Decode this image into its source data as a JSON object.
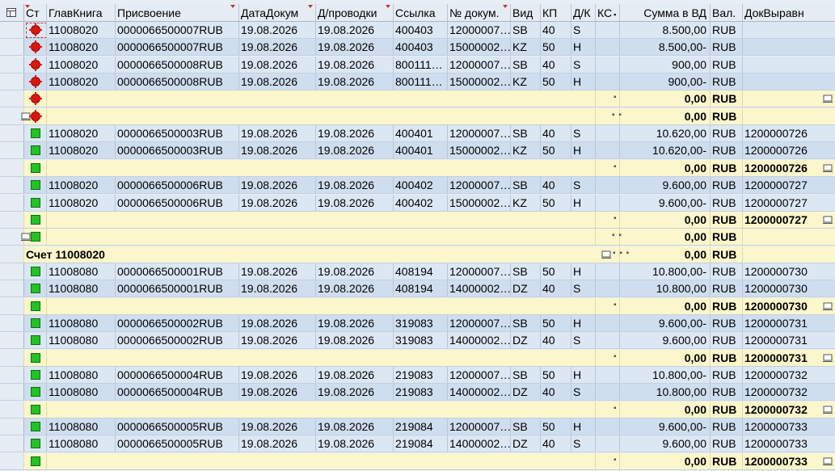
{
  "columns": {
    "status": "Ст",
    "gl": "ГлавКнига",
    "assign": "Присвоение",
    "docdate": "ДатаДокум",
    "postdate": "Д/проводки",
    "ref": "Ссылка",
    "docno": "№ докум.",
    "type": "Вид",
    "pk": "КП",
    "dc": "Д/К",
    "cs": "КС",
    "amount": "Сумма в ВД",
    "cur": "Вал.",
    "clr": "ДокВыравн"
  },
  "rows": [
    {
      "kind": "data",
      "status": "red",
      "gl": "11008020",
      "assign": "0000066500007RUB",
      "docdate": "19.08.2026",
      "postdate": "19.08.2026",
      "ref": "400403",
      "docno": "12000007…",
      "type": "SB",
      "pk": "40",
      "dc": "S",
      "amount": "8.500,00",
      "cur": "RUB",
      "clr": ""
    },
    {
      "kind": "data",
      "status": "red",
      "gl": "11008020",
      "assign": "0000066500007RUB",
      "docdate": "19.08.2026",
      "postdate": "19.08.2026",
      "ref": "400403",
      "docno": "15000002…",
      "type": "KZ",
      "pk": "50",
      "dc": "H",
      "amount": "8.500,00-",
      "cur": "RUB",
      "clr": ""
    },
    {
      "kind": "data",
      "status": "red",
      "gl": "11008020",
      "assign": "0000066500008RUB",
      "docdate": "19.08.2026",
      "postdate": "19.08.2026",
      "ref": "800111…",
      "docno": "12000007…",
      "type": "SB",
      "pk": "40",
      "dc": "S",
      "amount": "900,00",
      "cur": "RUB",
      "clr": ""
    },
    {
      "kind": "data",
      "status": "red",
      "gl": "11008020",
      "assign": "0000066500008RUB",
      "docdate": "19.08.2026",
      "postdate": "19.08.2026",
      "ref": "800111…",
      "docno": "15000002…",
      "type": "KZ",
      "pk": "50",
      "dc": "H",
      "amount": "900,00-",
      "cur": "RUB",
      "clr": ""
    },
    {
      "kind": "sub",
      "status": "red",
      "dots": "▪",
      "amount": "0,00",
      "cur": "RUB",
      "clr": "",
      "sumicon": true
    },
    {
      "kind": "sub",
      "status": "red",
      "lvl2": true,
      "dots": "▪ ▪",
      "amount": "0,00",
      "cur": "RUB",
      "clr": ""
    },
    {
      "kind": "data",
      "status": "green",
      "gl": "11008020",
      "assign": "0000066500003RUB",
      "docdate": "19.08.2026",
      "postdate": "19.08.2026",
      "ref": "400401",
      "docno": "12000007…",
      "type": "SB",
      "pk": "40",
      "dc": "S",
      "amount": "10.620,00",
      "cur": "RUB",
      "clr": "1200000726"
    },
    {
      "kind": "data",
      "status": "green",
      "gl": "11008020",
      "assign": "0000066500003RUB",
      "docdate": "19.08.2026",
      "postdate": "19.08.2026",
      "ref": "400401",
      "docno": "15000002…",
      "type": "KZ",
      "pk": "50",
      "dc": "H",
      "amount": "10.620,00-",
      "cur": "RUB",
      "clr": "1200000726"
    },
    {
      "kind": "sub",
      "status": "green",
      "dots": "▪",
      "amount": "0,00",
      "cur": "RUB",
      "clr": "1200000726",
      "sumicon": true
    },
    {
      "kind": "data",
      "status": "green",
      "gl": "11008020",
      "assign": "0000066500006RUB",
      "docdate": "19.08.2026",
      "postdate": "19.08.2026",
      "ref": "400402",
      "docno": "12000007…",
      "type": "SB",
      "pk": "40",
      "dc": "S",
      "amount": "9.600,00",
      "cur": "RUB",
      "clr": "1200000727"
    },
    {
      "kind": "data",
      "status": "green",
      "gl": "11008020",
      "assign": "0000066500006RUB",
      "docdate": "19.08.2026",
      "postdate": "19.08.2026",
      "ref": "400402",
      "docno": "15000002…",
      "type": "KZ",
      "pk": "50",
      "dc": "H",
      "amount": "9.600,00-",
      "cur": "RUB",
      "clr": "1200000727"
    },
    {
      "kind": "sub",
      "status": "green",
      "dots": "▪",
      "amount": "0,00",
      "cur": "RUB",
      "clr": "1200000727",
      "sumicon": true
    },
    {
      "kind": "sub",
      "status": "green",
      "lvl2": true,
      "dots": "▪ ▪",
      "amount": "0,00",
      "cur": "RUB",
      "clr": ""
    },
    {
      "kind": "total",
      "label": "Счет 11008020",
      "dots": "▪ ▪ ▪",
      "amount": "0,00",
      "cur": "RUB",
      "clr": ""
    },
    {
      "kind": "data",
      "status": "green",
      "gl": "11008080",
      "assign": "0000066500001RUB",
      "docdate": "19.08.2026",
      "postdate": "19.08.2026",
      "ref": "408194",
      "docno": "12000007…",
      "type": "SB",
      "pk": "50",
      "dc": "H",
      "amount": "10.800,00-",
      "cur": "RUB",
      "clr": "1200000730"
    },
    {
      "kind": "data",
      "status": "green",
      "gl": "11008080",
      "assign": "0000066500001RUB",
      "docdate": "19.08.2026",
      "postdate": "19.08.2026",
      "ref": "408194",
      "docno": "14000002…",
      "type": "DZ",
      "pk": "40",
      "dc": "S",
      "amount": "10.800,00",
      "cur": "RUB",
      "clr": "1200000730"
    },
    {
      "kind": "sub",
      "status": "green",
      "dots": "▪",
      "amount": "0,00",
      "cur": "RUB",
      "clr": "1200000730",
      "sumicon": true
    },
    {
      "kind": "data",
      "status": "green",
      "gl": "11008080",
      "assign": "0000066500002RUB",
      "docdate": "19.08.2026",
      "postdate": "19.08.2026",
      "ref": "319083",
      "docno": "12000007…",
      "type": "SB",
      "pk": "50",
      "dc": "H",
      "amount": "9.600,00-",
      "cur": "RUB",
      "clr": "1200000731"
    },
    {
      "kind": "data",
      "status": "green",
      "gl": "11008080",
      "assign": "0000066500002RUB",
      "docdate": "19.08.2026",
      "postdate": "19.08.2026",
      "ref": "319083",
      "docno": "14000002…",
      "type": "DZ",
      "pk": "40",
      "dc": "S",
      "amount": "9.600,00",
      "cur": "RUB",
      "clr": "1200000731"
    },
    {
      "kind": "sub",
      "status": "green",
      "dots": "▪",
      "amount": "0,00",
      "cur": "RUB",
      "clr": "1200000731",
      "sumicon": true
    },
    {
      "kind": "data",
      "status": "green",
      "gl": "11008080",
      "assign": "0000066500004RUB",
      "docdate": "19.08.2026",
      "postdate": "19.08.2026",
      "ref": "219083",
      "docno": "12000007…",
      "type": "SB",
      "pk": "50",
      "dc": "H",
      "amount": "10.800,00-",
      "cur": "RUB",
      "clr": "1200000732"
    },
    {
      "kind": "data",
      "status": "green",
      "gl": "11008080",
      "assign": "0000066500004RUB",
      "docdate": "19.08.2026",
      "postdate": "19.08.2026",
      "ref": "219083",
      "docno": "14000002…",
      "type": "DZ",
      "pk": "40",
      "dc": "S",
      "amount": "10.800,00",
      "cur": "RUB",
      "clr": "1200000732"
    },
    {
      "kind": "sub",
      "status": "green",
      "dots": "▪",
      "amount": "0,00",
      "cur": "RUB",
      "clr": "1200000732",
      "sumicon": true
    },
    {
      "kind": "data",
      "status": "green",
      "gl": "11008080",
      "assign": "0000066500005RUB",
      "docdate": "19.08.2026",
      "postdate": "19.08.2026",
      "ref": "219084",
      "docno": "12000007…",
      "type": "SB",
      "pk": "50",
      "dc": "H",
      "amount": "9.600,00-",
      "cur": "RUB",
      "clr": "1200000733"
    },
    {
      "kind": "data",
      "status": "green",
      "gl": "11008080",
      "assign": "0000066500005RUB",
      "docdate": "19.08.2026",
      "postdate": "19.08.2026",
      "ref": "219084",
      "docno": "14000002…",
      "type": "DZ",
      "pk": "40",
      "dc": "S",
      "amount": "9.600,00",
      "cur": "RUB",
      "clr": "1200000733"
    },
    {
      "kind": "sub",
      "status": "green",
      "dots": "▪",
      "amount": "0,00",
      "cur": "RUB",
      "clr": "1200000733",
      "sumicon": true
    }
  ],
  "colors": {
    "status_red": "#e0140c",
    "status_green": "#22c322",
    "row_blue": "#dce7f4",
    "row_yellow": "#fbf6cc",
    "sort_marker": "#c0392b"
  },
  "icons": {
    "layout": "layout-icon",
    "status_ok": "green-square-icon",
    "status_open": "red-circle-icon",
    "sum": "sum-icon"
  }
}
